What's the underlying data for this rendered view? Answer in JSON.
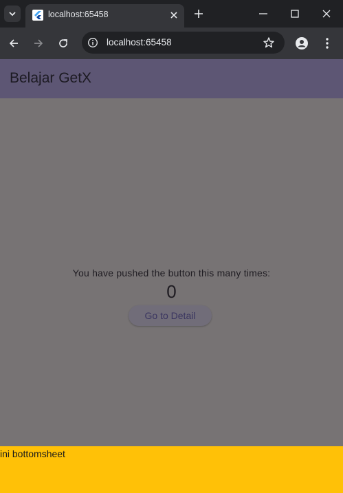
{
  "browser": {
    "tab_title": "localhost:65458",
    "url": "localhost:65458"
  },
  "app": {
    "title": "Belajar GetX",
    "counter_label": "You have pushed the button this many times:",
    "counter_value": "0",
    "detail_button_label": "Go to Detail",
    "bottomsheet_text": "ini bottomsheet"
  },
  "colors": {
    "appbar": "#5d5674",
    "scrim_background": "#777374",
    "bottomsheet": "#ffc107",
    "browser_dark": "#202124",
    "browser_toolbar": "#35363a"
  },
  "icons": [
    "tab-search-icon",
    "flutter-favicon-icon",
    "close-icon",
    "plus-icon",
    "minimize-icon",
    "maximize-icon",
    "window-close-icon",
    "back-arrow-icon",
    "forward-arrow-icon",
    "reload-icon",
    "site-info-icon",
    "star-icon",
    "profile-icon",
    "more-vertical-icon"
  ]
}
